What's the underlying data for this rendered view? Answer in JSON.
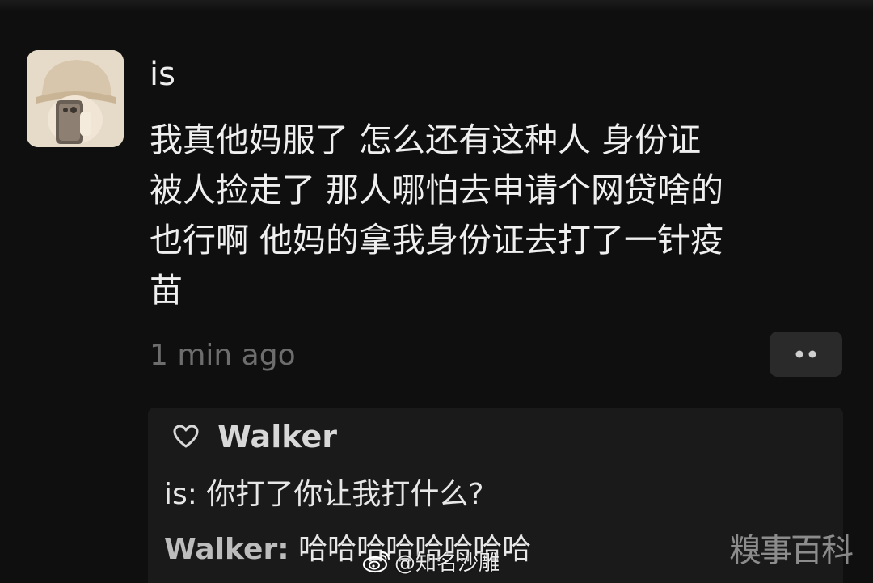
{
  "post": {
    "username": "is",
    "content_lines": [
      "我真他妈服了 怎么还有这种人 身份证",
      "被人捡走了 那人哪怕去申请个网贷啥的",
      "也行啊 他妈的拿我身份证去打了一针疫",
      "苗"
    ],
    "timestamp": "1 min ago",
    "more_icon": "more-dots-icon"
  },
  "likes": {
    "icon": "heart-icon",
    "name": "Walker"
  },
  "comments": [
    {
      "author": "is:",
      "text": "你打了你让我打什么?"
    },
    {
      "author": "Walker:",
      "text": "哈哈哈哈哈哈哈哈"
    }
  ],
  "watermarks": {
    "weibo": "@知名沙雕",
    "site": "糗事百科"
  },
  "colors": {
    "background": "#0f0f0f",
    "comment_panel": "#1a1a1a",
    "timestamp": "#6d6d6d",
    "text": "#efefef"
  }
}
